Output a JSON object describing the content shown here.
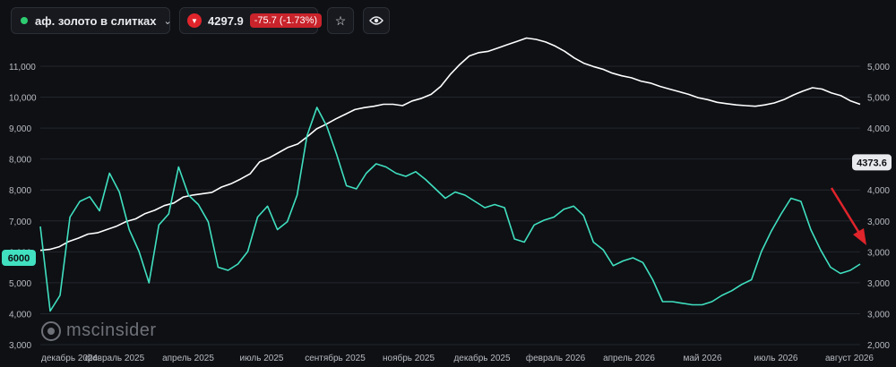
{
  "header": {
    "ticker_name": "аф. золото в слитках",
    "chevron_icon": "chevron-down-icon",
    "price": "4297.9",
    "change": "-75.7 (-1.73%)",
    "down_icon": "triangle-down-icon",
    "star_icon": "star-icon",
    "eye_icon": "eye-icon",
    "colors": {
      "up_dot": "#2ecc71",
      "down": "#e0242b"
    }
  },
  "watermark": {
    "text": "mscinsider"
  },
  "chart_data": {
    "type": "line",
    "x_labels": [
      "декабрь 2024",
      "февраль 2025",
      "апрель 2025",
      "июль 2025",
      "сентябрь 2025",
      "ноябрь 2025",
      "декабрь 2025",
      "февраль 2026",
      "апрель 2026",
      "май 2026",
      "июль 2026",
      "август 2026"
    ],
    "y_left_ticks": [
      "11,000",
      "10,000",
      "9,000",
      "8,000",
      "8,000",
      "7,000",
      "6,000",
      "5,000",
      "4,000",
      "3,000"
    ],
    "y_right_ticks": [
      "5,000",
      "5,000",
      "4,000",
      "4,000",
      "4,000",
      "3,000",
      "3,000",
      "3,000",
      "3,000",
      "2,000"
    ],
    "left_marker": "6000",
    "right_marker": "4373.6",
    "grid": true,
    "series": [
      {
        "color": "#ffffff",
        "axis": "right",
        "values": [
          3045,
          3060,
          3100,
          3180,
          3230,
          3290,
          3310,
          3360,
          3410,
          3480,
          3520,
          3600,
          3650,
          3720,
          3760,
          3850,
          3880,
          3900,
          3920,
          4000,
          4050,
          4120,
          4200,
          4380,
          4440,
          4520,
          4600,
          4650,
          4760,
          4880,
          4950,
          5030,
          5100,
          5170,
          5200,
          5220,
          5250,
          5250,
          5230,
          5300,
          5340,
          5400,
          5520,
          5700,
          5850,
          5980,
          6030,
          6050,
          6100,
          6150,
          6200,
          6250,
          6230,
          6190,
          6130,
          6050,
          5950,
          5870,
          5820,
          5780,
          5720,
          5680,
          5650,
          5600,
          5570,
          5520,
          5480,
          5440,
          5400,
          5350,
          5320,
          5280,
          5260,
          5240,
          5230,
          5220,
          5240,
          5270,
          5320,
          5390,
          5450,
          5500,
          5480,
          5420,
          5380,
          5300,
          5250
        ]
      },
      {
        "color": "#40e0c0",
        "axis": "left",
        "values": [
          7000,
          4300,
          4800,
          7300,
          7800,
          7950,
          7500,
          8700,
          8100,
          6900,
          6200,
          5200,
          7050,
          7400,
          8900,
          8000,
          7700,
          7150,
          5700,
          5600,
          5800,
          6200,
          7300,
          7650,
          6900,
          7150,
          8000,
          9900,
          10800,
          10200,
          9300,
          8300,
          8200,
          8700,
          9000,
          8900,
          8700,
          8600,
          8750,
          8500,
          8200,
          7900,
          8100,
          8000,
          7800,
          7600,
          7700,
          7600,
          6600,
          6500,
          7050,
          7200,
          7300,
          7550,
          7650,
          7350,
          6500,
          6250,
          5750,
          5900,
          6000,
          5850,
          5300,
          4600,
          4600,
          4550,
          4500,
          4500,
          4600,
          4800,
          4950,
          5150,
          5300,
          6200,
          6850,
          7400,
          7900,
          7800,
          6900,
          6250,
          5700,
          5500,
          5600,
          5800
        ]
      }
    ]
  }
}
